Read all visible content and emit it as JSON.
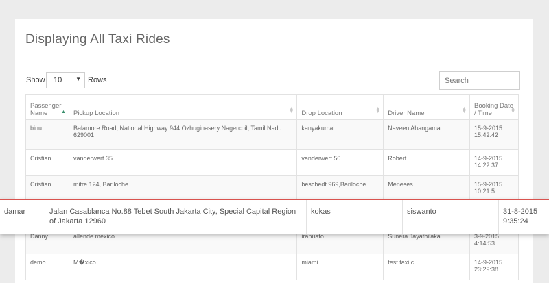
{
  "page_title": "Displaying All Taxi Rides",
  "controls": {
    "show_label": "Show",
    "rows_value": "10",
    "rows_label": "Rows",
    "search_placeholder": "Search"
  },
  "table": {
    "headers": [
      "Passenger Name",
      "Pickup Location",
      "Drop Location",
      "Driver Name",
      "Booking Date / Time"
    ],
    "rows": [
      {
        "passenger": "binu",
        "pickup": "Balamore Road, National Highway 944 Ozhuginasery Nagercoil, Tamil Nadu 629001",
        "drop": "kanyakumai",
        "driver": "Naveen Ahangama",
        "date": "15-9-2015",
        "time": "15:42:42"
      },
      {
        "passenger": "Cristian",
        "pickup": "vanderwert 35",
        "drop": "vanderwert 50",
        "driver": "Robert",
        "date": "14-9-2015",
        "time": "14:22:37"
      },
      {
        "passenger": "Cristian",
        "pickup": "mitre 124, Bariloche",
        "drop": "beschedt 969,Bariloche",
        "driver": "Meneses",
        "date": "15-9-2015",
        "time": "10:21:5"
      },
      {
        "passenger": "damar",
        "pickup": "",
        "drop": "",
        "driver": "",
        "date": "",
        "time": ""
      },
      {
        "passenger": "Danny",
        "pickup": "allende méxico",
        "drop": "irapuato",
        "driver": "Sunera Jayathilaka",
        "date": "3-9-2015",
        "time": "4:14:53"
      },
      {
        "passenger": "demo",
        "pickup": "M�xico",
        "drop": "miami",
        "driver": "test taxi c",
        "date": "14-9-2015",
        "time": "23:29:38"
      }
    ]
  },
  "highlight_row": {
    "passenger": "damar",
    "pickup": "Jalan Casablanca No.88 Tebet South Jakarta City, Special Capital Region of Jakarta 12960",
    "drop": "kokas",
    "driver": "siswanto",
    "date": "31-8-2015",
    "time": "9:35:24"
  },
  "colors": {
    "sort_active": "#3a8f6d",
    "highlight_border": "#d9534f"
  }
}
